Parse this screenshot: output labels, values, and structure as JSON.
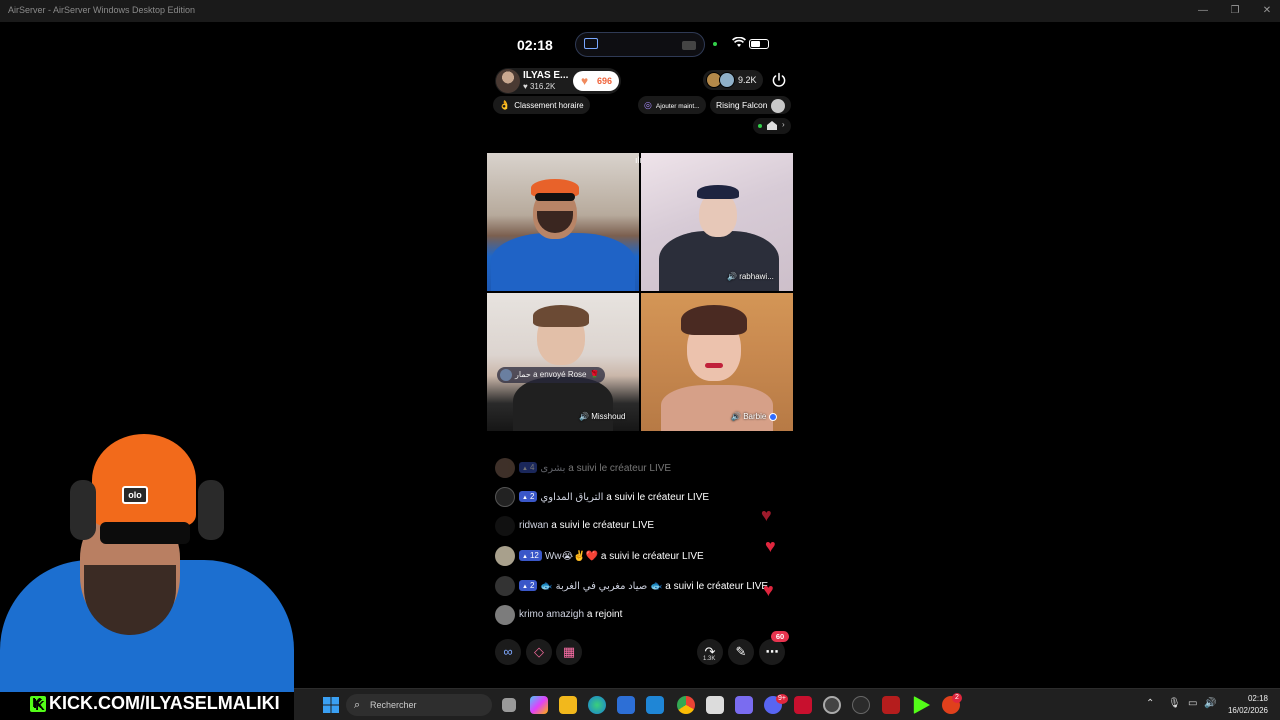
{
  "window": {
    "title": "AirServer - AirServer Windows Desktop Edition",
    "min": "—",
    "max": "❐",
    "close": "✕"
  },
  "status": {
    "time": "02:18",
    "battery_fraction": 0.55
  },
  "live": {
    "host_name": "ILYAS E...",
    "host_likes": "♥ 316.2K",
    "heart_count": "696",
    "viewer_count": "9.2K",
    "chips": {
      "ranking": "Classement horaire",
      "add": "Ajouter maint...",
      "rising": "Rising Falcon"
    }
  },
  "guests": {
    "tile2_name": "rabhawi...",
    "tile3_name": "Misshoud",
    "tile4_name": "Barbie"
  },
  "gift": {
    "user": "حمار",
    "text": "a envoyé",
    "item": "Rose"
  },
  "chat": [
    {
      "user": "بشرى",
      "level": "4",
      "action": "a suivi le créateur LIVE"
    },
    {
      "user": "الترياق المداوي",
      "level": "2",
      "action": "a suivi le créateur LIVE"
    },
    {
      "user": "ridwan",
      "level": "",
      "action": "a suivi le créateur LIVE"
    },
    {
      "user": "Ww😭✌️❤️",
      "level": "12",
      "action": "a suivi le créateur LIVE"
    },
    {
      "user": "🐟 صياد مغربي في الغربة 🐟",
      "level": "2",
      "action": "a suivi le créateur LIVE"
    },
    {
      "user": "krimo amazigh",
      "level": "",
      "action": "a rejoint"
    }
  ],
  "bottom": {
    "more_badge": "60",
    "share_count": "1.3K"
  },
  "overlay": {
    "kick_url": "KICK.COM/ILYASELMALIKI",
    "kick_logo": "K"
  },
  "taskbar": {
    "search_placeholder": "Rechercher",
    "time": "02:18",
    "date": "16/02/2026",
    "badge_discord": "9+",
    "badge_last": "2"
  },
  "colors": {
    "accent_red": "#e0263e",
    "kick_green": "#53fc18",
    "taskbar": "#202020"
  }
}
